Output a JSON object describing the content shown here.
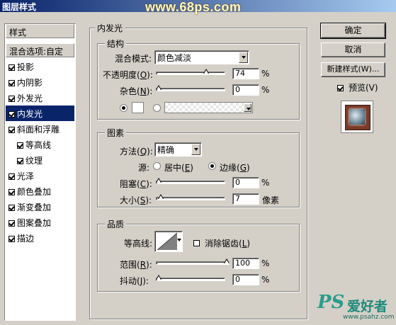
{
  "window": {
    "title": "图层样式",
    "watermark": "www.68ps.com"
  },
  "styles_panel": {
    "header": "样式",
    "blend_options": "混合选项:自定",
    "items": [
      {
        "label": "投影",
        "checked": true,
        "selected": false,
        "indent": false
      },
      {
        "label": "内阴影",
        "checked": true,
        "selected": false,
        "indent": false
      },
      {
        "label": "外发光",
        "checked": true,
        "selected": false,
        "indent": false
      },
      {
        "label": "内发光",
        "checked": true,
        "selected": true,
        "indent": false
      },
      {
        "label": "斜面和浮雕",
        "checked": true,
        "selected": false,
        "indent": false
      },
      {
        "label": "等高线",
        "checked": true,
        "selected": false,
        "indent": true
      },
      {
        "label": "纹理",
        "checked": true,
        "selected": false,
        "indent": true
      },
      {
        "label": "光泽",
        "checked": true,
        "selected": false,
        "indent": false
      },
      {
        "label": "颜色叠加",
        "checked": true,
        "selected": false,
        "indent": false
      },
      {
        "label": "渐变叠加",
        "checked": true,
        "selected": false,
        "indent": false
      },
      {
        "label": "图案叠加",
        "checked": true,
        "selected": false,
        "indent": false
      },
      {
        "label": "描边",
        "checked": true,
        "selected": false,
        "indent": false
      }
    ]
  },
  "inner_glow": {
    "title": "内发光",
    "structure": {
      "title": "结构",
      "blend_mode_label": "混合模式:",
      "blend_mode_value": "颜色减淡",
      "opacity_label": "不透明度",
      "opacity_key": "O",
      "opacity_value": "74",
      "opacity_fraction": 0.74,
      "noise_label": "杂色",
      "noise_key": "N",
      "noise_value": "0",
      "noise_fraction": 0,
      "percent": "%"
    },
    "elements": {
      "title": "图素",
      "method_label": "方法",
      "method_key": "Q",
      "method_value": "精确",
      "source_label": "源:",
      "center_label": "居中",
      "center_key": "E",
      "edge_label": "边缘",
      "edge_key": "G",
      "choke_label": "阻塞",
      "choke_key": "C",
      "choke_value": "0",
      "choke_fraction": 0,
      "size_label": "大小",
      "size_key": "S",
      "size_value": "7",
      "size_fraction": 0.03,
      "size_unit": "像素",
      "percent": "%"
    },
    "quality": {
      "title": "品质",
      "contour_label": "等高线:",
      "antialias_label": "消除锯齿",
      "antialias_key": "L",
      "range_label": "范围",
      "range_key": "R",
      "range_value": "100",
      "range_fraction": 1,
      "jitter_label": "抖动",
      "jitter_key": "J",
      "jitter_value": "0",
      "jitter_fraction": 0,
      "percent": "%"
    }
  },
  "buttons": {
    "ok": "确定",
    "cancel": "取消",
    "new_style": "新建样式(W)...",
    "preview_label": "预览(V)"
  },
  "logo": {
    "ps": "PS",
    "text": "爱好者",
    "url": "www.psahz.com"
  }
}
